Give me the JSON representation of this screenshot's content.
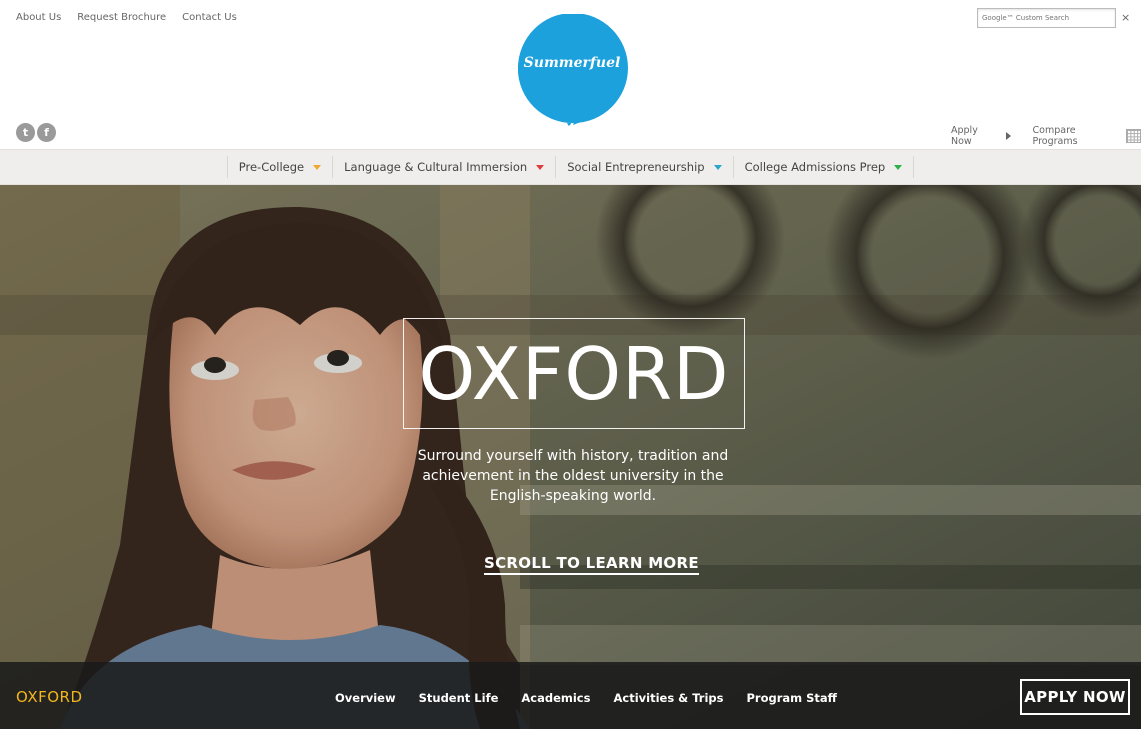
{
  "util_links": [
    "About Us",
    "Request Brochure",
    "Contact Us"
  ],
  "search": {
    "placeholder": "Google™ Custom Search",
    "close_label": "×"
  },
  "logo": {
    "text": "Summerfuel",
    "color": "#1da1dc"
  },
  "social": {
    "twitter_glyph": "t",
    "facebook_glyph": "f"
  },
  "top_actions": {
    "apply": "Apply Now",
    "compare": "Compare Programs"
  },
  "nav": [
    {
      "label": "Pre-College",
      "caret_color": "#f0a830"
    },
    {
      "label": "Language & Cultural Immersion",
      "caret_color": "#e23b3b"
    },
    {
      "label": "Social Entrepreneurship",
      "caret_color": "#2aa6c9"
    },
    {
      "label": "College Admissions Prep",
      "caret_color": "#2fb14a"
    }
  ],
  "hero": {
    "title": "OXFORD",
    "tagline": "Surround yourself with history, tradition and achievement in the oldest university in the English-speaking world.",
    "scroll": "SCROLL TO LEARN MORE"
  },
  "program_bar": {
    "name": "OXFORD",
    "name_color": "#f2b71c",
    "tabs": [
      "Overview",
      "Student Life",
      "Academics",
      "Activities & Trips",
      "Program Staff"
    ],
    "apply": "APPLY NOW"
  }
}
